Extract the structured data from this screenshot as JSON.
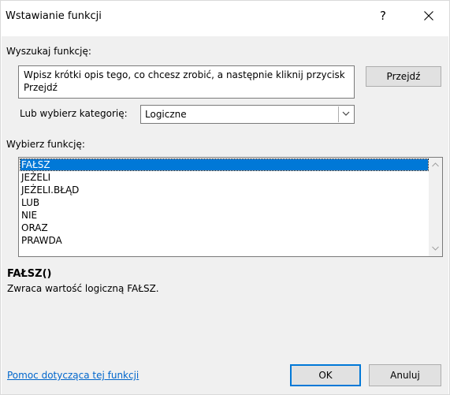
{
  "window": {
    "title": "Wstawianie funkcji",
    "help_glyph": "?",
    "close_glyph": "✕"
  },
  "search": {
    "label": "Wyszukaj funkcję:",
    "value": "Wpisz krótki opis tego, co chcesz zrobić, a następnie kliknij przycisk Przejdź",
    "go_button": "Przejdź"
  },
  "category": {
    "label": "Lub wybierz kategorię:",
    "selected": "Logiczne"
  },
  "functions": {
    "label": "Wybierz funkcję:",
    "items": [
      "FAŁSZ",
      "JEŻELI",
      "JEŻELI.BŁĄD",
      "LUB",
      "NIE",
      "ORAZ",
      "PRAWDA"
    ],
    "selected_index": 0
  },
  "details": {
    "signature": "FAŁSZ()",
    "description": "Zwraca wartość logiczną FAŁSZ."
  },
  "footer": {
    "help_link": "Pomoc dotycząca tej funkcji",
    "ok": "OK",
    "cancel": "Anuluj"
  },
  "colors": {
    "accent": "#0078d7",
    "link": "#0066cc",
    "dialog_bg": "#f0f0f0"
  }
}
